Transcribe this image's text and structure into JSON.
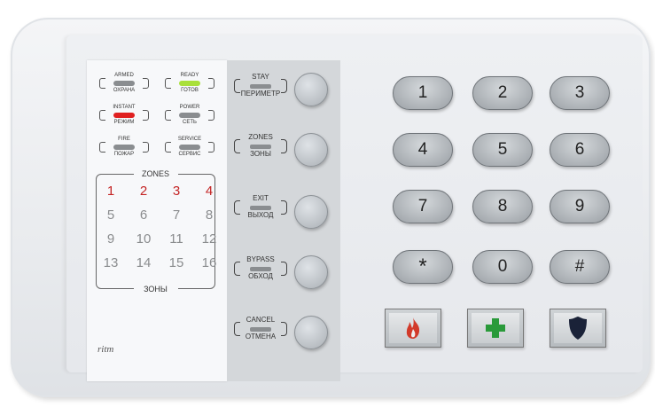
{
  "leds": [
    {
      "top": "ARMED",
      "bottom": "ОХРАНА",
      "color": "#8a8d90"
    },
    {
      "top": "READY",
      "bottom": "ГОТОВ",
      "color": "#a9e03a"
    },
    {
      "top": "INSTANT",
      "bottom": "РЕЖИМ",
      "color": "#e02020"
    },
    {
      "top": "POWER",
      "bottom": "СЕТЬ",
      "color": "#8a8d90"
    },
    {
      "top": "FIRE",
      "bottom": "ПОЖАР",
      "color": "#8a8d90"
    },
    {
      "top": "SERVICE",
      "bottom": "СЕРВИС",
      "color": "#8a8d90"
    }
  ],
  "zones": {
    "title_top": "ZONES",
    "title_bottom": "ЗОНЫ",
    "numbers": [
      "1",
      "2",
      "3",
      "4",
      "5",
      "6",
      "7",
      "8",
      "9",
      "10",
      "11",
      "12",
      "13",
      "14",
      "15",
      "16"
    ],
    "active": [
      "1",
      "2",
      "3",
      "4"
    ],
    "active_color": "#c42424"
  },
  "function_buttons": [
    {
      "top": "STAY",
      "bottom": "ПЕРИМЕТР"
    },
    {
      "top": "ZONES",
      "bottom": "ЗОНЫ"
    },
    {
      "top": "EXIT",
      "bottom": "ВЫХОД"
    },
    {
      "top": "BYPASS",
      "bottom": "ОБХОД"
    },
    {
      "top": "CANCEL",
      "bottom": "ОТМЕНА"
    }
  ],
  "keypad": [
    "1",
    "2",
    "3",
    "4",
    "5",
    "6",
    "7",
    "8",
    "9",
    "*",
    "0",
    "#"
  ],
  "emergency": [
    {
      "icon": "fire-icon",
      "color": "#d23a2a"
    },
    {
      "icon": "medical-cross-icon",
      "color": "#2a9a3a"
    },
    {
      "icon": "police-shield-icon",
      "color": "#1a2238"
    }
  ],
  "brand": "ritm"
}
